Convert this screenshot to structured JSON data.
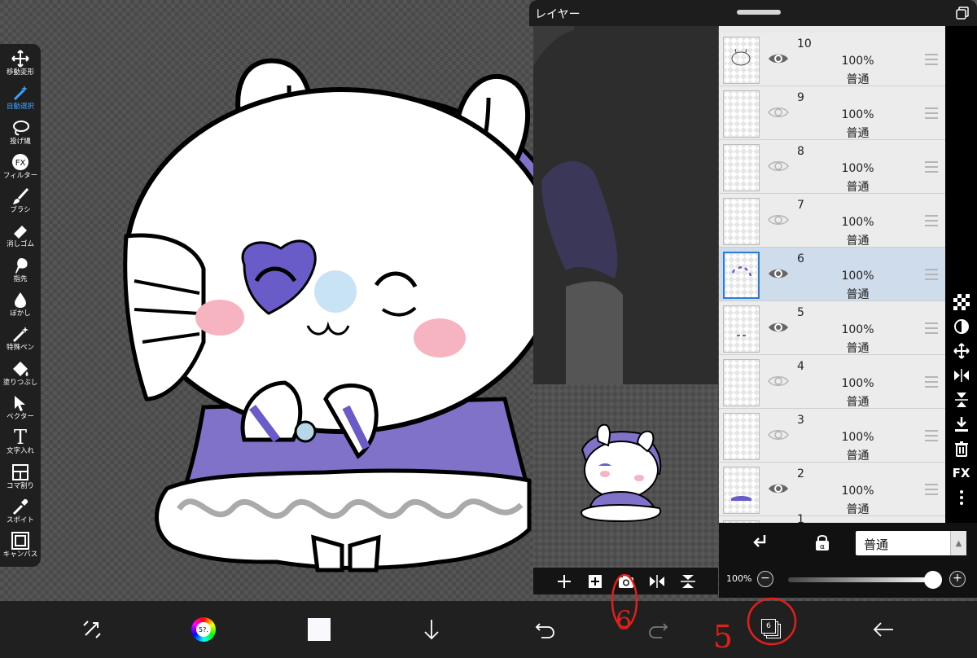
{
  "toolbar": {
    "tools": [
      {
        "label": "移動変形",
        "icon": "move-icon"
      },
      {
        "label": "自動選択",
        "icon": "magic-wand-icon",
        "active": true
      },
      {
        "label": "投げ縄",
        "icon": "lasso-icon"
      },
      {
        "label": "フィルター",
        "icon": "fx-icon",
        "icon_text": "FX"
      },
      {
        "label": "ブラシ",
        "icon": "brush-icon"
      },
      {
        "label": "消しゴム",
        "icon": "eraser-icon"
      },
      {
        "label": "指先",
        "icon": "finger-icon"
      },
      {
        "label": "ぼかし",
        "icon": "blur-icon"
      },
      {
        "label": "特殊ペン",
        "icon": "special-pen-icon"
      },
      {
        "label": "塗りつぶし",
        "icon": "fill-bucket-icon"
      },
      {
        "label": "ベクター",
        "icon": "vector-icon"
      },
      {
        "label": "文字入れ",
        "icon": "text-icon",
        "icon_text": "T"
      },
      {
        "label": "コマ割り",
        "icon": "panel-divide-icon"
      },
      {
        "label": "スポイト",
        "icon": "eyedropper-icon"
      },
      {
        "label": "キャンバス",
        "icon": "canvas-icon"
      }
    ]
  },
  "layer_panel": {
    "title": "レイヤー",
    "layers": [
      {
        "number": "10",
        "opacity": "100%",
        "blend": "普通",
        "visible": true
      },
      {
        "number": "9",
        "opacity": "100%",
        "blend": "普通",
        "visible": false
      },
      {
        "number": "8",
        "opacity": "100%",
        "blend": "普通",
        "visible": false
      },
      {
        "number": "7",
        "opacity": "100%",
        "blend": "普通",
        "visible": false
      },
      {
        "number": "6",
        "opacity": "100%",
        "blend": "普通",
        "visible": true,
        "selected": true
      },
      {
        "number": "5",
        "opacity": "100%",
        "blend": "普通",
        "visible": true
      },
      {
        "number": "4",
        "opacity": "100%",
        "blend": "普通",
        "visible": false
      },
      {
        "number": "3",
        "opacity": "100%",
        "blend": "普通",
        "visible": false
      },
      {
        "number": "2",
        "opacity": "100%",
        "blend": "普通",
        "visible": true
      },
      {
        "number": "1",
        "opacity": "",
        "blend": "",
        "visible": true
      }
    ],
    "top_partial_blend": "普通",
    "blend_mode": "普通",
    "opacity_label": "100%",
    "opacity_value": 1.0,
    "side_icons": [
      "checker-icon",
      "contrast-icon",
      "move-icon",
      "flip-horizontal-icon",
      "flip-vertical-icon",
      "merge-down-icon",
      "trash-icon",
      "fx-icon",
      "more-icon"
    ],
    "fx_text": "FX"
  },
  "bottom_bar": {
    "color_wheel_text": "5?."
  },
  "layer_count": "6",
  "annotations": [
    "6",
    "5"
  ],
  "colors": {
    "accent": "#3fa2ff",
    "purple": "#7f72c8",
    "selected_layer": "#cfdcec",
    "annotation_red": "#e0201b"
  }
}
